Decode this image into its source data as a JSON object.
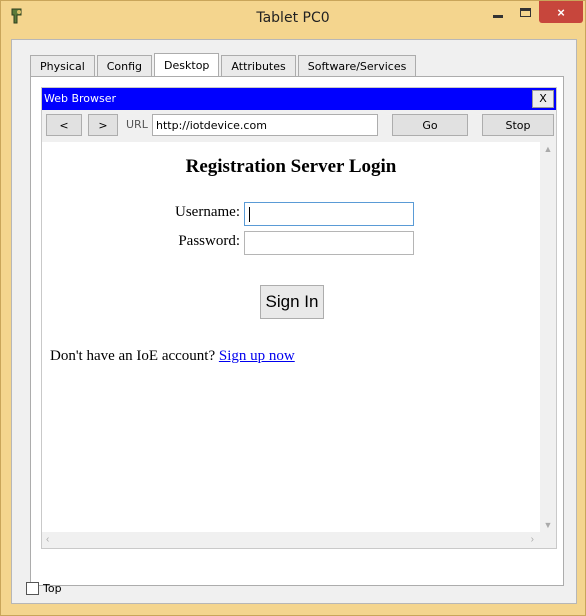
{
  "window": {
    "title": "Tablet PC0",
    "close_glyph": "×",
    "icon": "packet-tracer-icon"
  },
  "tabs": [
    {
      "label": "Physical"
    },
    {
      "label": "Config"
    },
    {
      "label": "Desktop",
      "active": true
    },
    {
      "label": "Attributes"
    },
    {
      "label": "Software/Services"
    }
  ],
  "browser": {
    "title": "Web Browser",
    "close_label": "X",
    "back_label": "<",
    "forward_label": ">",
    "url_label": "URL",
    "url_value": "http://iotdevice.com",
    "go_label": "Go",
    "stop_label": "Stop",
    "title_bar_color": "#0000ff"
  },
  "page": {
    "heading": "Registration Server Login",
    "username_label": "Username:",
    "username_value": "",
    "password_label": "Password:",
    "password_value": "",
    "sign_in_label": "Sign In",
    "signup_prompt": "Don't have an IoE account? ",
    "signup_link": "Sign up now"
  },
  "footer": {
    "top_checkbox_label": "Top",
    "top_checked": false
  }
}
